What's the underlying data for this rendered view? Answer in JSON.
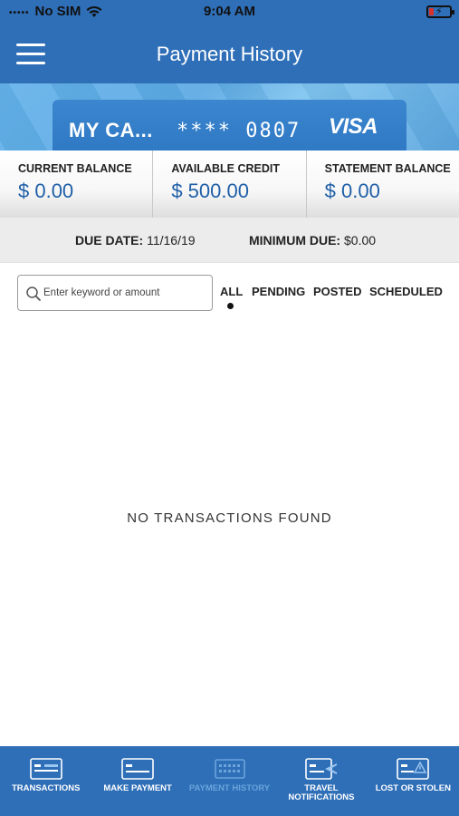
{
  "status_bar": {
    "carrier": "No SIM",
    "time": "9:04 AM"
  },
  "nav": {
    "title": "Payment History"
  },
  "card": {
    "name": "MY CA...",
    "number": "**** 0807",
    "brand": "VISA"
  },
  "balances": [
    {
      "label": "CURRENT BALANCE",
      "value": "$ 0.00"
    },
    {
      "label": "AVAILABLE CREDIT",
      "value": "$ 500.00"
    },
    {
      "label": "STATEMENT BALANCE",
      "value": "$ 0.00"
    }
  ],
  "due": {
    "date_label": "DUE DATE:",
    "date_value": "11/16/19",
    "min_label": "MINIMUM DUE:",
    "min_value": "$0.00"
  },
  "search": {
    "placeholder": "Enter keyword or amount",
    "value": ""
  },
  "filters": {
    "all": "ALL",
    "pending": "PENDING",
    "posted": "POSTED",
    "scheduled": "SCHEDULED",
    "active": "ALL"
  },
  "empty_message": "NO TRANSACTIONS FOUND",
  "bottom_nav": [
    {
      "label": "TRANSACTIONS",
      "icon": "card-list-icon"
    },
    {
      "label": "MAKE PAYMENT",
      "icon": "card-icon"
    },
    {
      "label": "PAYMENT HISTORY",
      "icon": "calendar-icon",
      "active": true
    },
    {
      "label": "TRAVEL NOTIFICATIONS",
      "icon": "card-airplane-icon"
    },
    {
      "label": "LOST OR STOLEN",
      "icon": "card-alert-icon"
    }
  ],
  "colors": {
    "primary": "#2f6fb8",
    "value_blue": "#1f5fa8",
    "active_tab": "#6aa4db"
  }
}
